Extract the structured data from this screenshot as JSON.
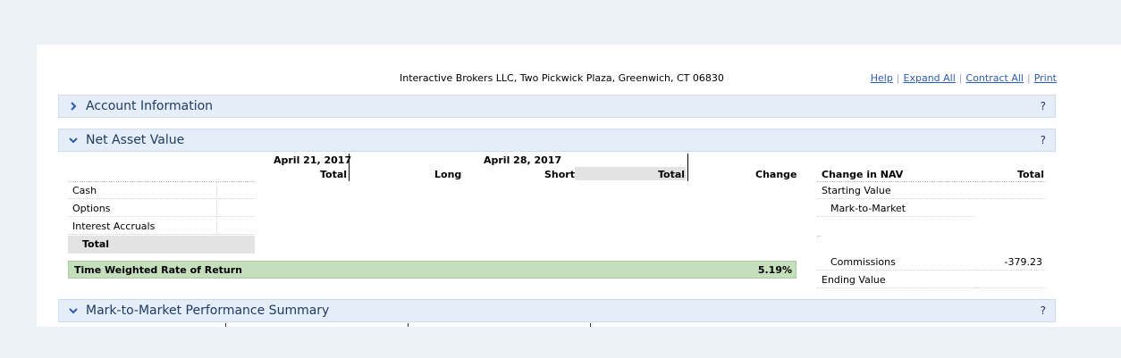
{
  "header": {
    "address": "Interactive Brokers LLC, Two Pickwick Plaza, Greenwich, CT 06830",
    "links": [
      "Help",
      "Expand All",
      "Contract All",
      "Print"
    ]
  },
  "sections": {
    "account_information": {
      "title": "Account Information",
      "help": "?",
      "expanded": false
    },
    "net_asset_value": {
      "title": "Net Asset Value",
      "help": "?",
      "expanded": true
    },
    "mtm_summary": {
      "title": "Mark-to-Market Performance Summary",
      "help": "?",
      "expanded": true
    }
  },
  "nav_table": {
    "date1": "April 21, 2017",
    "date2": "April 28, 2017",
    "col_total_1": "Total",
    "col_long": "Long",
    "col_short": "Short",
    "col_total_2": "Total",
    "col_change": "Change",
    "rows": [
      "Cash",
      "Options",
      "Interest Accruals"
    ],
    "total_row": "Total",
    "twrr_label": "Time Weighted Rate of Return",
    "twrr_value": "5.19%"
  },
  "change_in_nav": {
    "header": "Change in NAV",
    "total_header": "Total",
    "starting_value": "Starting Value",
    "mark_to_market": "Mark-to-Market",
    "commissions": "Commissions",
    "commissions_value": "-379.23",
    "ending_value": "Ending Value"
  },
  "colors": {
    "page_bg": "#ecf1f8",
    "section_bar": "#e5eef8",
    "link": "#2a5ab8",
    "twrr_bg": "#c5dfbd",
    "total_bg": "#e3e3e3"
  },
  "icons": {
    "collapsed": "chevron-right-icon",
    "expanded": "chevron-down-icon"
  }
}
